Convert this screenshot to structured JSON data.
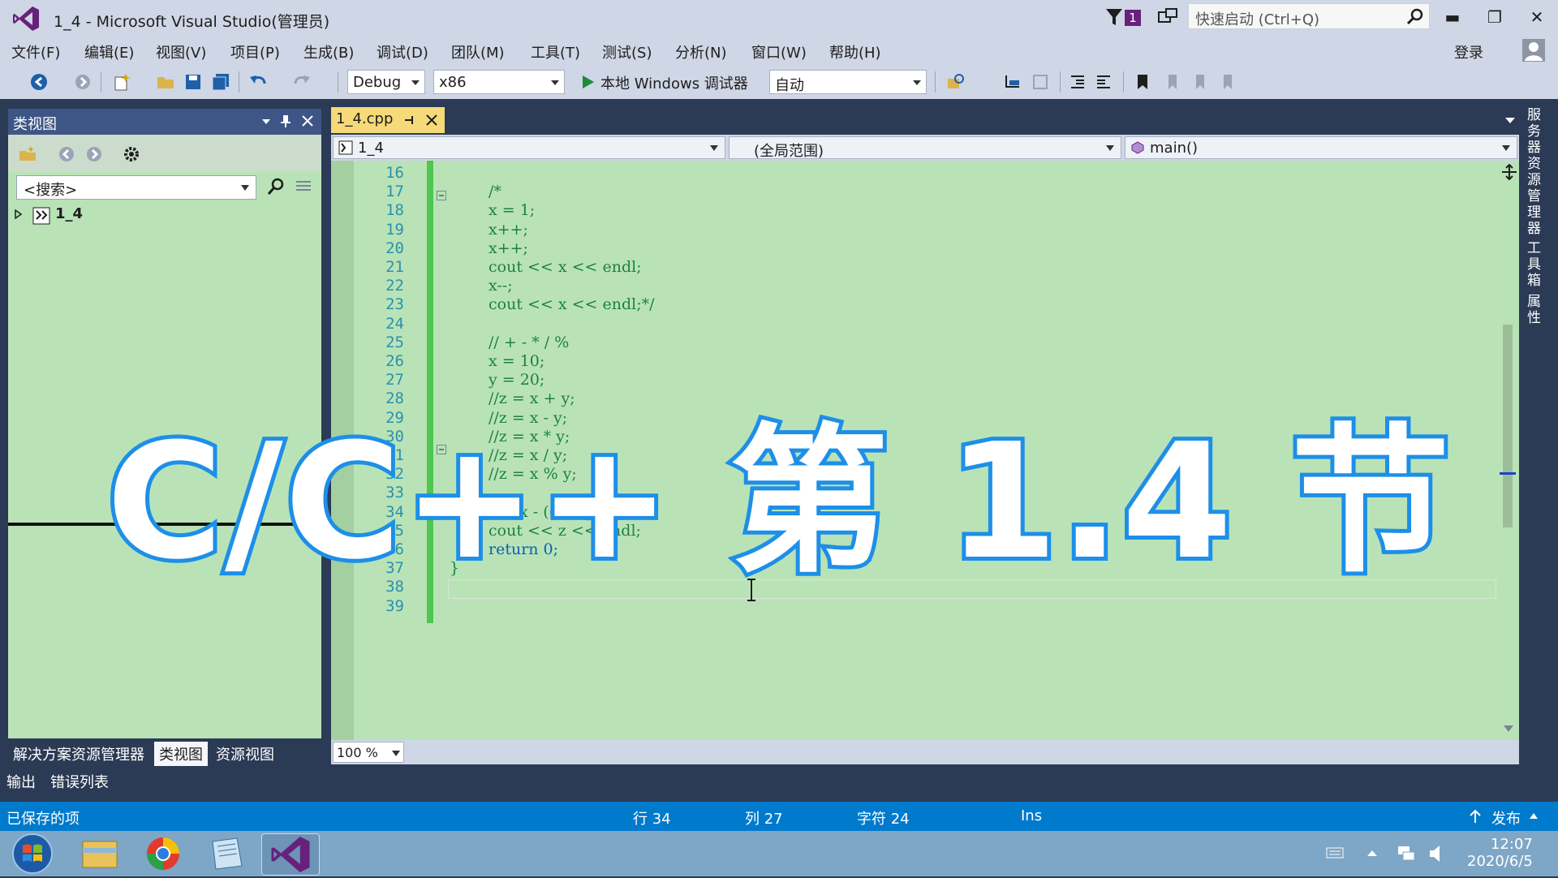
{
  "window": {
    "title": "1_4 - Microsoft Visual Studio(管理员)",
    "notification_count": "1"
  },
  "quick_launch": {
    "placeholder": "快速启动 (Ctrl+Q)"
  },
  "window_buttons": {
    "minimize": "▬",
    "restore": "❐",
    "close": "✕"
  },
  "menu": [
    "文件(F)",
    "编辑(E)",
    "视图(V)",
    "项目(P)",
    "生成(B)",
    "调试(D)",
    "团队(M)",
    "工具(T)",
    "测试(S)",
    "分析(N)",
    "窗口(W)",
    "帮助(H)"
  ],
  "account": {
    "login": "登录"
  },
  "toolbar": {
    "config": "Debug",
    "platform": "x86",
    "run": "本地 Windows 调试器",
    "mode": "自动"
  },
  "class_view": {
    "title": "类视图",
    "search": "<搜索>",
    "tree_root": "1_4",
    "tabs": [
      "解决方案资源管理器",
      "类视图",
      "资源视图"
    ]
  },
  "bottom_tabs": [
    "输出",
    "错误列表"
  ],
  "editor": {
    "tab": "1_4.cpp",
    "nav": {
      "project": "1_4",
      "scope": "(全局范围)",
      "member": "main()"
    },
    "lines": [
      {
        "num": "16",
        "text": ""
      },
      {
        "num": "17",
        "text": "/*"
      },
      {
        "num": "18",
        "text": "x = 1;"
      },
      {
        "num": "19",
        "text": "x++;"
      },
      {
        "num": "20",
        "text": "x++;"
      },
      {
        "num": "21",
        "text": "cout << x << endl;"
      },
      {
        "num": "22",
        "text": "x--;"
      },
      {
        "num": "23",
        "text": "cout << x << endl;*/"
      },
      {
        "num": "24",
        "text": ""
      },
      {
        "num": "25",
        "text": "// + - * / %"
      },
      {
        "num": "26",
        "text": "x = 10;"
      },
      {
        "num": "27",
        "text": "y = 20;"
      },
      {
        "num": "28",
        "text": "//z = x + y;"
      },
      {
        "num": "29",
        "text": "//z = x - y;"
      },
      {
        "num": "30",
        "text": "//z = x * y;"
      },
      {
        "num": "31",
        "text": "//z = x / y;"
      },
      {
        "num": "32",
        "text": "//z = x % y;"
      },
      {
        "num": "33",
        "text": ""
      },
      {
        "num": "34",
        "text": "z = x - ((x + y) * x);"
      },
      {
        "num": "35",
        "text": "cout << z << endl;"
      },
      {
        "num": "36",
        "text": "return 0;"
      },
      {
        "num": "37",
        "text": "}"
      },
      {
        "num": "38",
        "text": ""
      },
      {
        "num": "39",
        "text": ""
      }
    ],
    "zoom": "100 %"
  },
  "right_tabs": [
    "服务器资源管理器",
    "工具箱",
    "属性"
  ],
  "status": {
    "saved": "已保存的项",
    "line": "行 34",
    "col": "列 27",
    "char": "字符 24",
    "mode": "Ins",
    "publish": "发布"
  },
  "taskbar": {
    "time": "12:07",
    "date": "2020/6/5"
  },
  "overlay": {
    "text": "C/C++ 第 1.4 节"
  },
  "colors": {
    "accent": "#007acc",
    "editor_bg": "#b9e3b7",
    "vs_purple": "#68217a"
  }
}
